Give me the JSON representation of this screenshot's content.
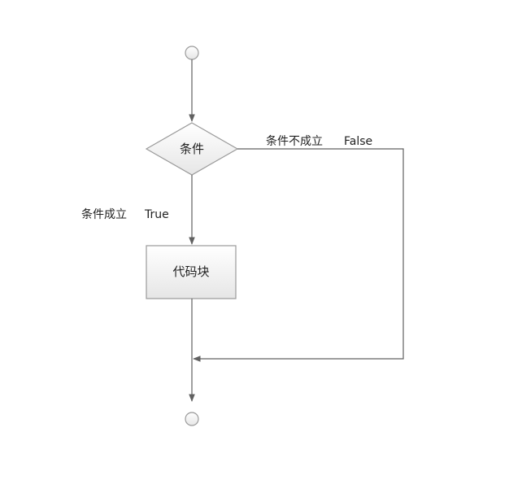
{
  "diagram": {
    "condition": "条件",
    "block": "代码块",
    "false_branch": {
      "condition_label": "条件不成立",
      "value_label": "False"
    },
    "true_branch": {
      "condition_label": "条件成立",
      "value_label": "True"
    }
  },
  "colors": {
    "line": "#606060",
    "node_border": "#9a9a9a",
    "node_fill_top": "#ffffff",
    "node_fill_bottom": "#e6e6e6",
    "text": "#222222"
  }
}
